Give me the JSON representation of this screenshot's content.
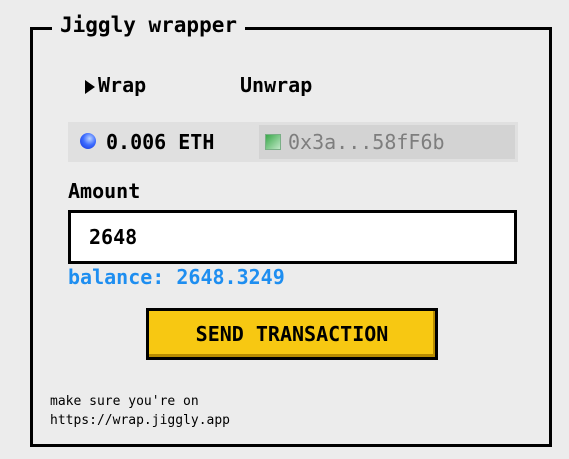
{
  "app": {
    "title": "Jiggly wrapper"
  },
  "tabs": {
    "wrap_label": "Wrap",
    "unwrap_label": "Unwrap"
  },
  "token": {
    "amount": "0.006 ETH",
    "address": "0x3a...58fF6b",
    "eth_icon": "eth-coin-icon",
    "address_icon": "identicon"
  },
  "form": {
    "amount_label": "Amount",
    "amount_value": "2648",
    "balance_text": "balance: 2648.3249",
    "submit_label": "SEND TRANSACTION"
  },
  "footer": {
    "line1": "make sure you're on",
    "line2": "https://wrap.jiggly.app"
  },
  "colors": {
    "background": "#ececec",
    "accent_button": "#f7c812",
    "balance_text": "#1e8ef0",
    "address_text": "#7e7e7e"
  }
}
